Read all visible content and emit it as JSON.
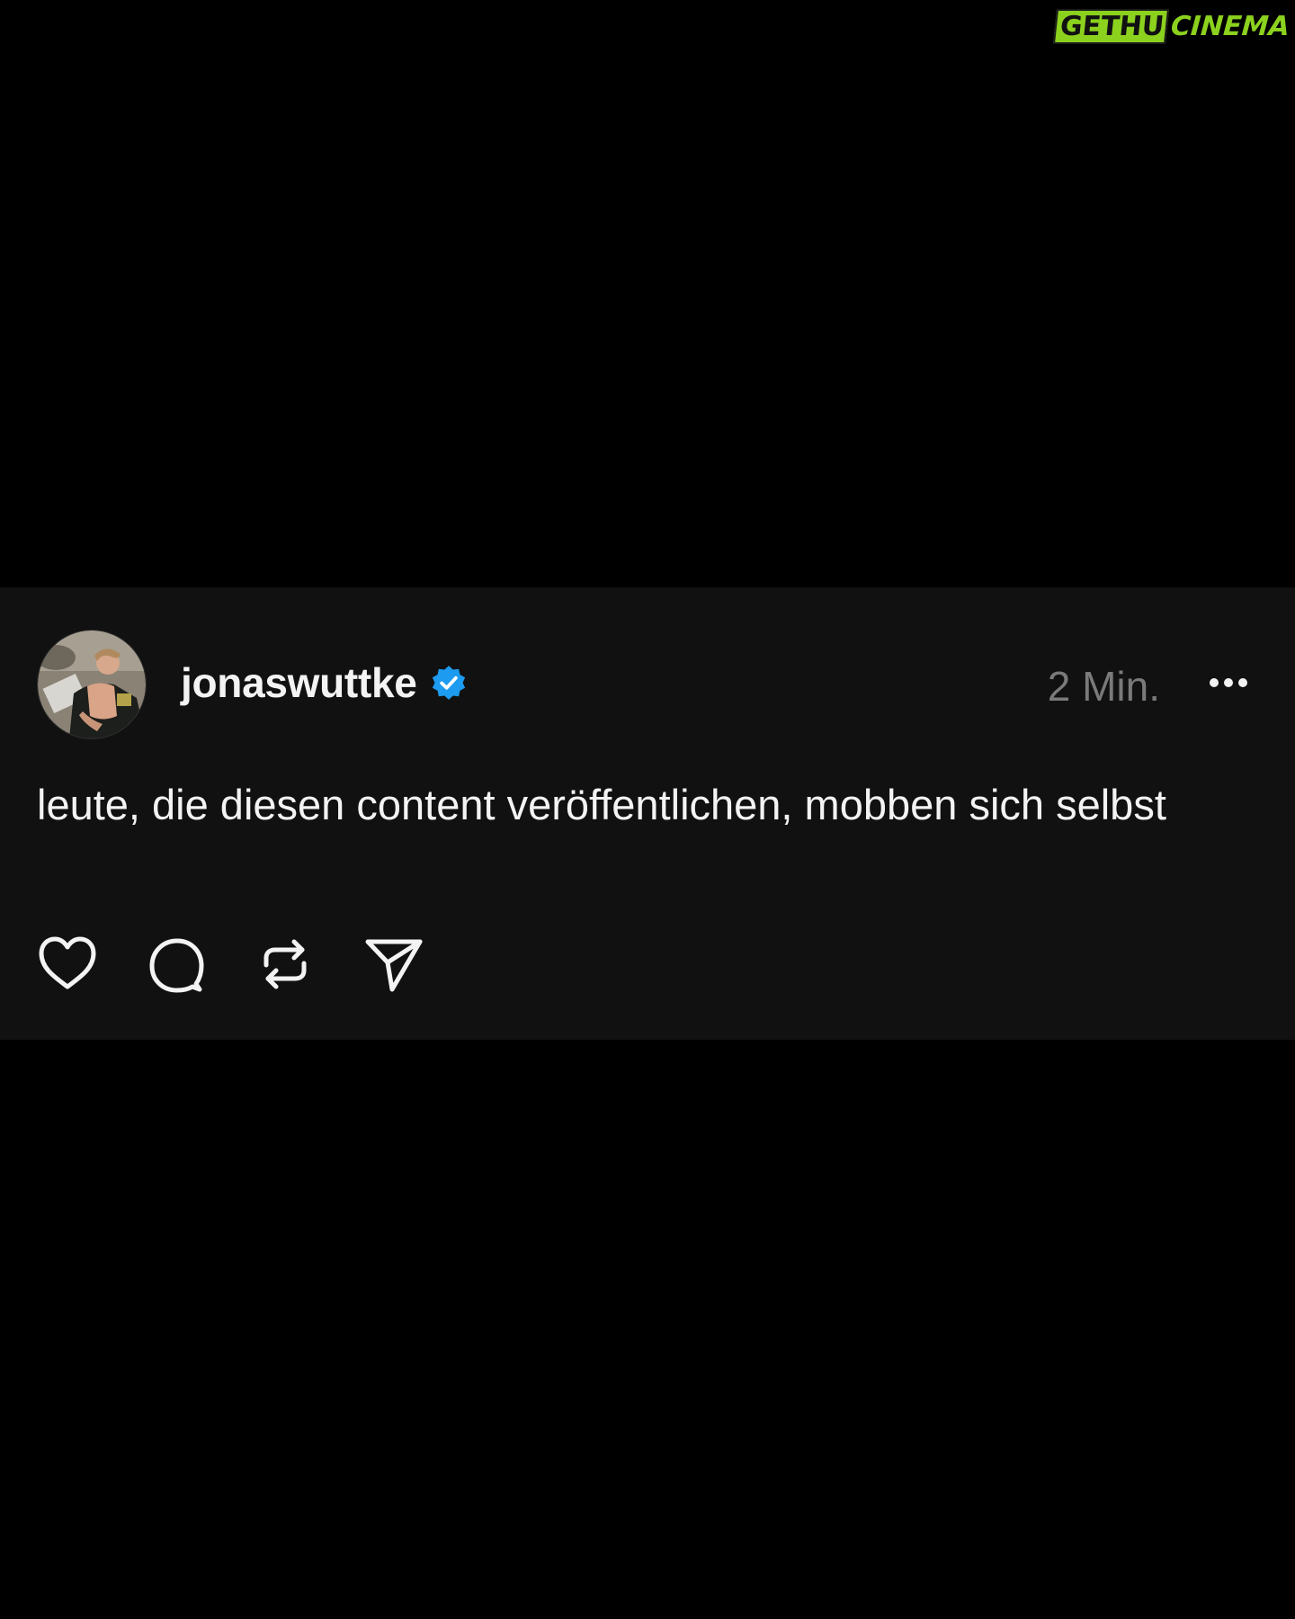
{
  "watermark": {
    "part_one": "GETHU",
    "part_two": "CINEMA"
  },
  "post": {
    "username": "jonaswuttke",
    "verified": true,
    "timestamp": "2 Min.",
    "text": "leute, die diesen content veröffentlichen, mobben sich selbst",
    "avatar_icon": "profile-photo",
    "actions": [
      {
        "name": "like",
        "icon": "heart-icon"
      },
      {
        "name": "reply",
        "icon": "comment-icon"
      },
      {
        "name": "repost",
        "icon": "repost-icon"
      },
      {
        "name": "share",
        "icon": "send-icon"
      }
    ],
    "more_icon": "more-horizontal-icon"
  },
  "colors": {
    "background": "#000000",
    "card": "#111111",
    "text": "#f3f3f3",
    "muted": "#7a7a7a",
    "verified_blue": "#1d9bf0",
    "watermark_green": "#8bd11e"
  }
}
